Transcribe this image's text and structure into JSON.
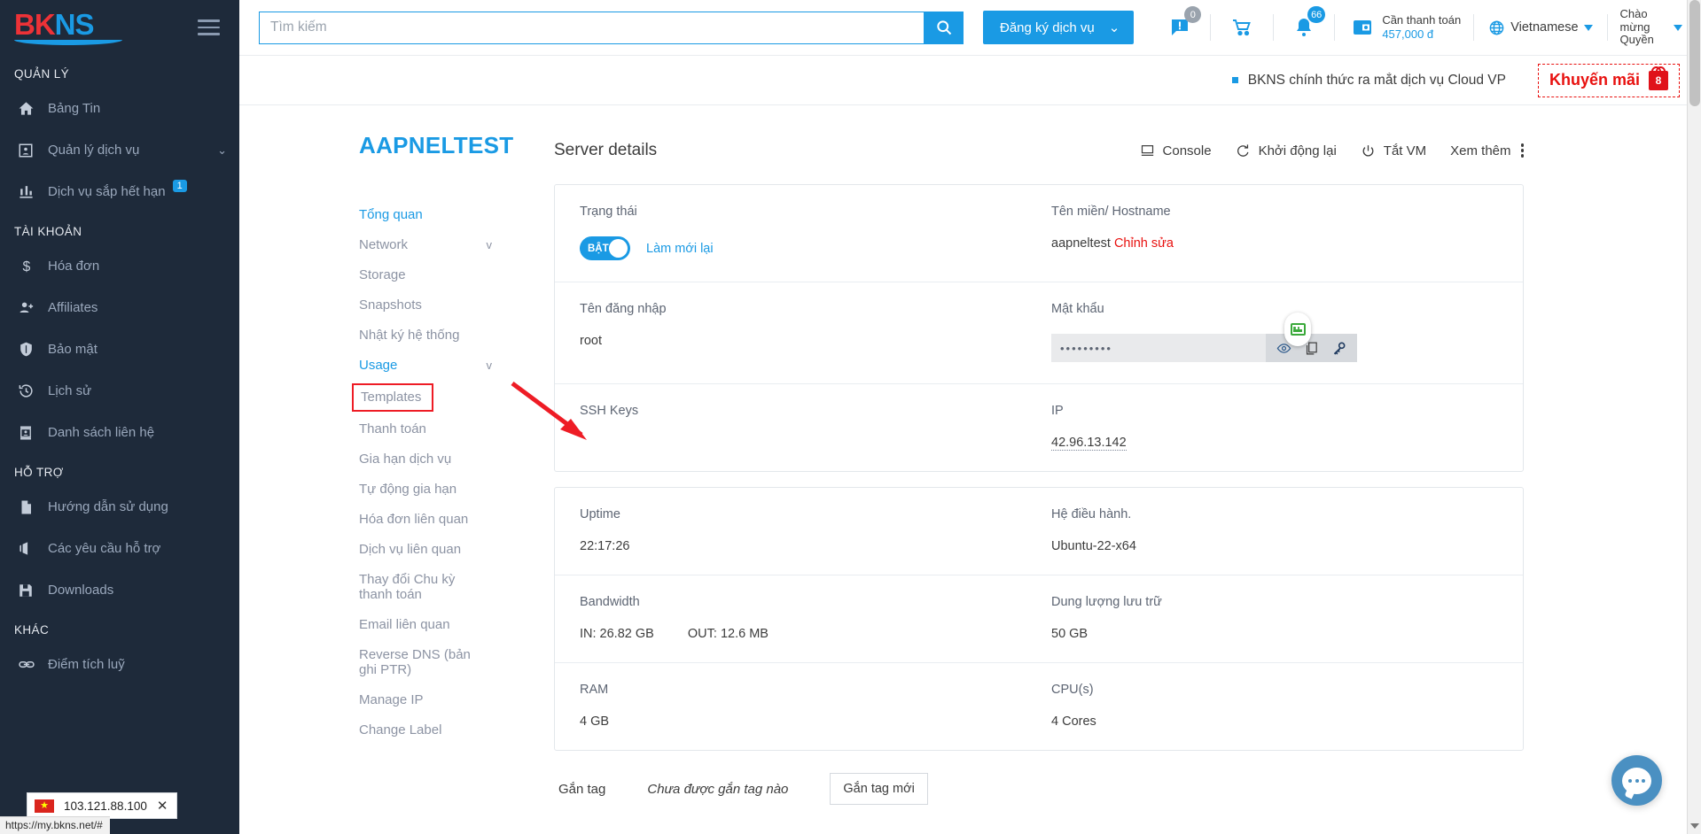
{
  "sidebar": {
    "logo": "BKNS",
    "sections": [
      {
        "title": "QUẢN LÝ",
        "items": [
          {
            "label": "Bảng Tin",
            "icon": "home-icon",
            "badge": null,
            "chevron": false
          },
          {
            "label": "Quản lý dịch vụ",
            "icon": "service-card-icon",
            "badge": null,
            "chevron": true
          },
          {
            "label": "Dịch vụ sắp hết hạn",
            "icon": "bar-chart-icon",
            "badge": "1",
            "chevron": false
          }
        ]
      },
      {
        "title": "TÀI KHOẢN",
        "items": [
          {
            "label": "Hóa đơn",
            "icon": "dollar-icon",
            "badge": null,
            "chevron": false
          },
          {
            "label": "Affiliates",
            "icon": "add-user-icon",
            "badge": null,
            "chevron": false
          },
          {
            "label": "Bảo mật",
            "icon": "shield-icon",
            "badge": null,
            "chevron": false
          },
          {
            "label": "Lịch sử",
            "icon": "history-icon",
            "badge": null,
            "chevron": false
          },
          {
            "label": "Danh sách liên hệ",
            "icon": "contact-card-icon",
            "badge": null,
            "chevron": false
          }
        ]
      },
      {
        "title": "HỖ TRỢ",
        "items": [
          {
            "label": "Hướng dẫn sử dụng",
            "icon": "document-icon",
            "badge": null,
            "chevron": false
          },
          {
            "label": "Các yêu cầu hỗ trợ",
            "icon": "ticket-icon",
            "badge": null,
            "chevron": false
          },
          {
            "label": "Downloads",
            "icon": "save-disk-icon",
            "badge": null,
            "chevron": false
          }
        ]
      },
      {
        "title": "KHÁC",
        "items": [
          {
            "label": "Điểm tích luỹ",
            "icon": "link-icon",
            "badge": null,
            "chevron": false
          }
        ]
      }
    ]
  },
  "header": {
    "search_placeholder": "Tìm kiếm",
    "search_value": "",
    "register_button": "Đăng ký dịch vụ",
    "messages_badge": "0",
    "cart_badge": "",
    "notifications_badge": "66",
    "payment_label": "Cần thanh toán",
    "payment_amount": "457,000 đ",
    "language": "Vietnamese",
    "welcome": "Chào mừng Quyền"
  },
  "promo": {
    "news_text": "BKNS chính thức ra mắt dịch vụ Cloud VP",
    "button_label": "Khuyến mãi",
    "gift_count": "8"
  },
  "page": {
    "title": "AAPNELTEST"
  },
  "subnav": {
    "items": [
      {
        "label": "Tổng quan",
        "active": true,
        "chevron": "",
        "highlight": false
      },
      {
        "label": "Network",
        "active": false,
        "chevron": "v",
        "highlight": false
      },
      {
        "label": "Storage",
        "active": false,
        "chevron": "",
        "highlight": false
      },
      {
        "label": "Snapshots",
        "active": false,
        "chevron": "",
        "highlight": false
      },
      {
        "label": "Nhật ký hệ thống",
        "active": false,
        "chevron": "",
        "highlight": false
      },
      {
        "label": "Usage",
        "active": true,
        "chevron": "v",
        "highlight": false
      },
      {
        "label": "Templates",
        "active": false,
        "chevron": "",
        "highlight": true
      },
      {
        "label": "Thanh toán",
        "active": false,
        "chevron": "",
        "highlight": false
      },
      {
        "label": "Gia hạn dịch vụ",
        "active": false,
        "chevron": "",
        "highlight": false
      },
      {
        "label": "Tự động gia hạn",
        "active": false,
        "chevron": "",
        "highlight": false
      },
      {
        "label": "Hóa đơn liên quan",
        "active": false,
        "chevron": "",
        "highlight": false
      },
      {
        "label": "Dịch vụ liên quan",
        "active": false,
        "chevron": "",
        "highlight": false
      },
      {
        "label": "Thay đổi Chu kỳ thanh toán",
        "active": false,
        "chevron": "",
        "highlight": false
      },
      {
        "label": "Email liên quan",
        "active": false,
        "chevron": "",
        "highlight": false
      },
      {
        "label": "Reverse DNS (bản ghi PTR)",
        "active": false,
        "chevron": "",
        "highlight": false
      },
      {
        "label": "Manage IP",
        "active": false,
        "chevron": "",
        "highlight": false
      },
      {
        "label": "Change Label",
        "active": false,
        "chevron": "",
        "highlight": false
      }
    ]
  },
  "server_details": {
    "title": "Server details",
    "actions": [
      {
        "label": "Console",
        "icon": "monitor-icon"
      },
      {
        "label": "Khởi động lại",
        "icon": "restart-icon"
      },
      {
        "label": "Tắt VM",
        "icon": "power-icon"
      },
      {
        "label": "Xem thêm",
        "icon": ""
      }
    ],
    "card1": [
      {
        "left": {
          "label": "Trạng thái",
          "value": "",
          "toggle": "BẬT",
          "link": "Làm mới lại"
        },
        "right": {
          "label": "Tên miền/ Hostname",
          "value": "aapneltest",
          "edit": "Chỉnh sửa"
        }
      },
      {
        "left": {
          "label": "Tên đăng nhập",
          "value": "root"
        },
        "right": {
          "label": "Mật khẩu",
          "value": "•••••••••"
        }
      },
      {
        "left": {
          "label": "SSH Keys",
          "value": ""
        },
        "right": {
          "label": "IP",
          "value": "42.96.13.142"
        }
      }
    ],
    "card2": [
      {
        "left": {
          "label": "Uptime",
          "value": "22:17:26"
        },
        "right": {
          "label": "Hệ điều hành.",
          "value": "Ubuntu-22-x64"
        }
      },
      {
        "left": {
          "label": "Bandwidth",
          "value": "IN: 26.82 GB",
          "value2": "OUT: 12.6 MB"
        },
        "right": {
          "label": "Dung lượng lưu trữ",
          "value": "50 GB"
        }
      },
      {
        "left": {
          "label": "RAM",
          "value": "4 GB"
        },
        "right": {
          "label": "CPU(s)",
          "value": "4 Cores"
        }
      }
    ],
    "tags": {
      "label": "Gắn tag",
      "empty_text": "Chưa được gắn tag nào",
      "add_button": "Gắn tag mới"
    }
  },
  "browser": {
    "ip_popup": "103.121.88.100",
    "status_url": "https://my.bkns.net/#"
  },
  "colors": {
    "brand_blue": "#1a9ae4",
    "sidebar_bg": "#1e2a3a",
    "annotation_red": "#ee1c25",
    "logo_red": "#ed3237"
  }
}
